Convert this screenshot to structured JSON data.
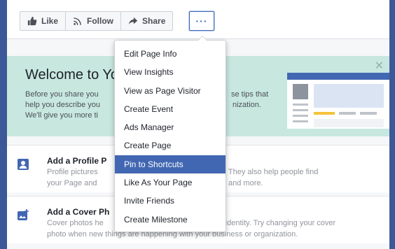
{
  "action_bar": {
    "like_label": "Like",
    "follow_label": "Follow",
    "share_label": "Share",
    "more_label": "···"
  },
  "welcome": {
    "title": "Welcome to Yo",
    "body": "Before you share you... these tips that help you describe you... nization. We'll give you more ti..."
  },
  "welcome_body_lines": [
    "Before you share you",
    "help you describe you",
    "We'll give you more ti"
  ],
  "welcome_body_right": [
    "se tips that",
    "nization."
  ],
  "cards": [
    {
      "title": "Add a Profile P",
      "line1_left": "Profile pictures",
      "line1_right": "or your Page. They also help people find",
      "line2_left": "your Page and",
      "line2_right": "ments and more."
    },
    {
      "title": "Add a Cover Ph",
      "line1_left": "Cover photos he",
      "line1_right": "'s identity. Try changing your cover",
      "line2": "photo when new things are happening with your business or organization."
    }
  ],
  "dropdown": {
    "items": [
      "Edit Page Info",
      "View Insights",
      "View as Page Visitor",
      "Create Event",
      "Ads Manager",
      "Create Page",
      "Pin to Shortcuts",
      "Like As Your Page",
      "Invite Friends",
      "Create Milestone"
    ],
    "highlighted": "Pin to Shortcuts"
  },
  "colors": {
    "brand": "#3b5998",
    "highlight": "#4267b2",
    "welcome_bg": "#c8e8df"
  }
}
